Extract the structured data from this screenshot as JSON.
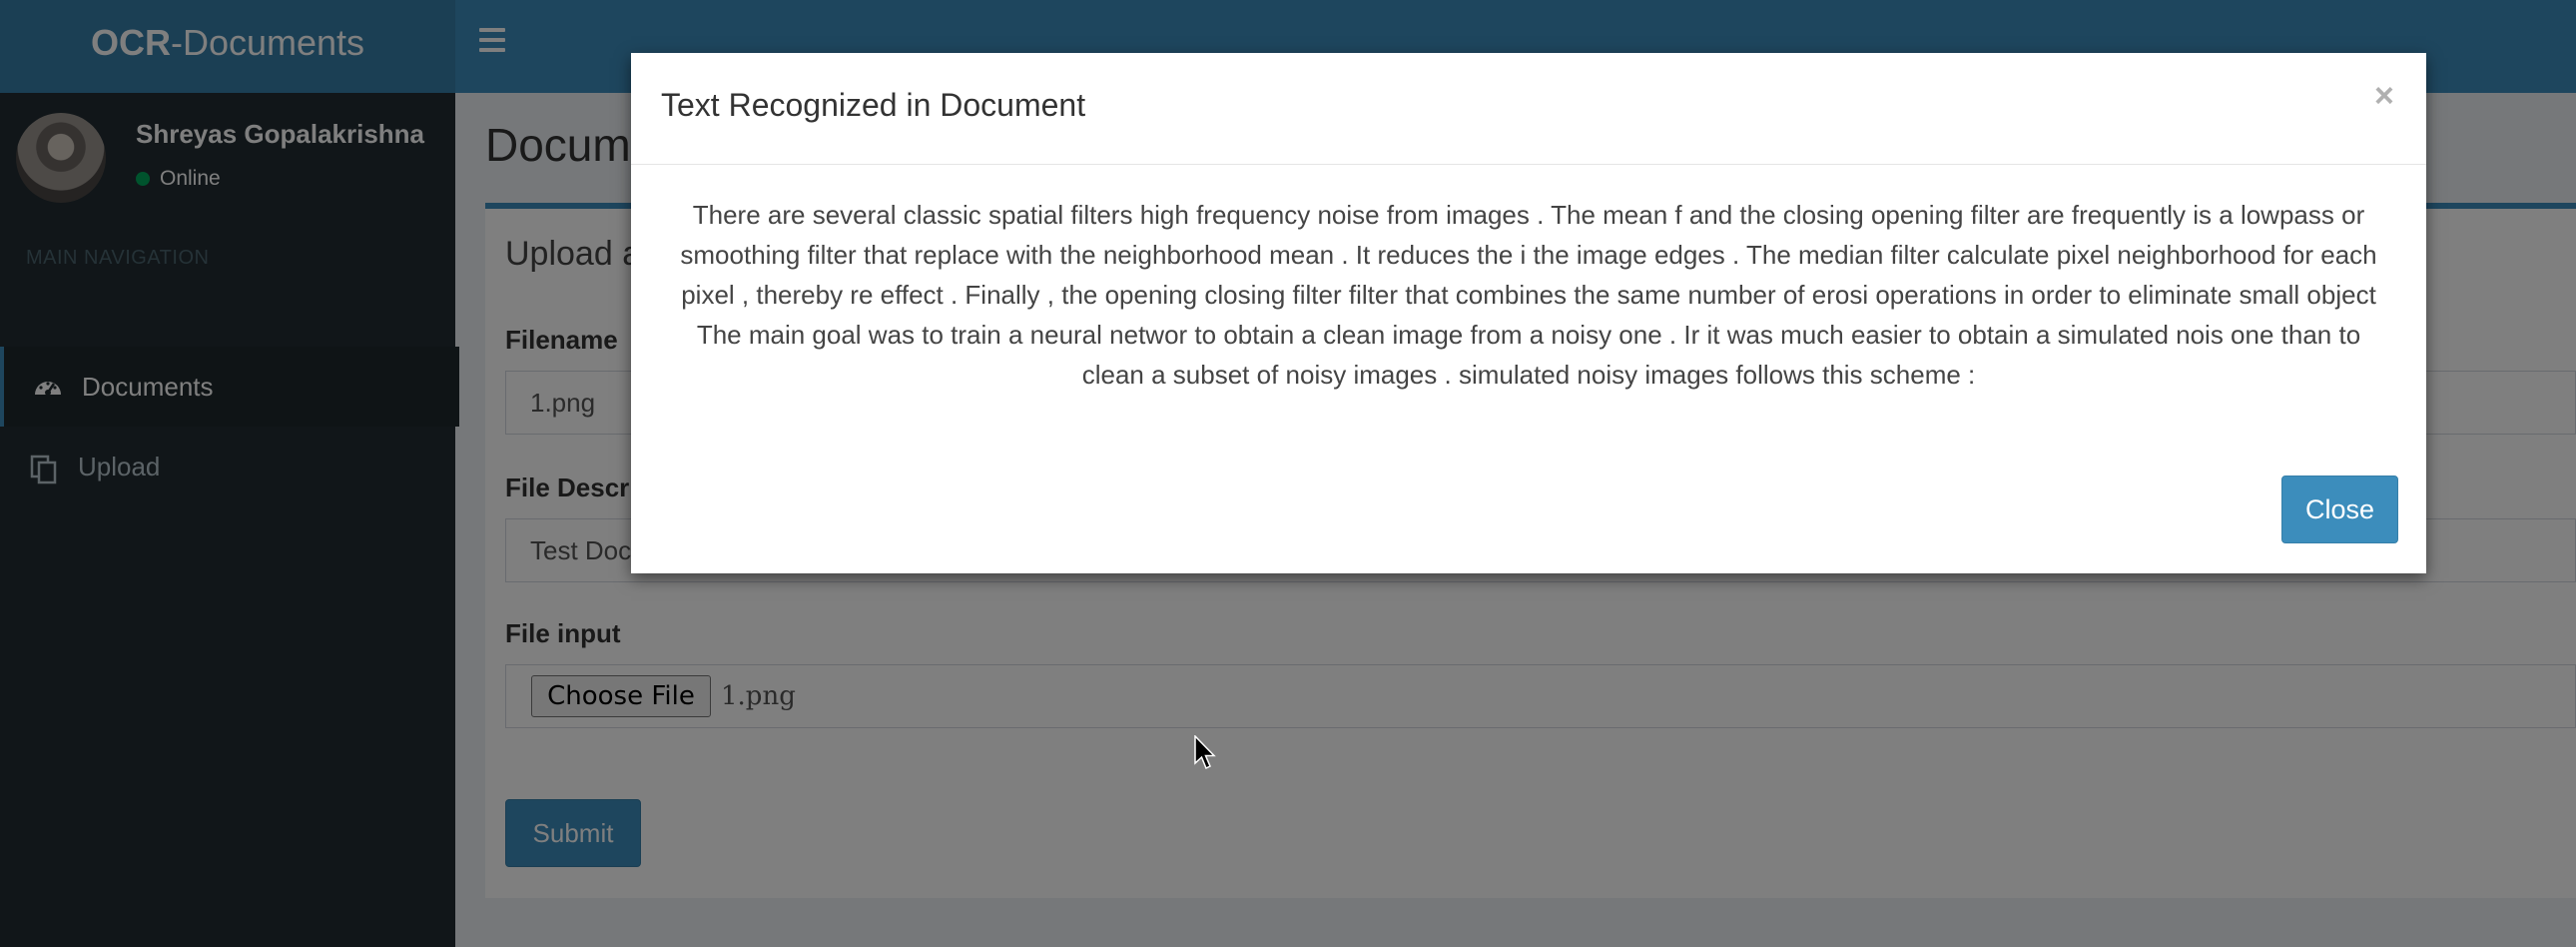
{
  "header": {
    "logo_bold": "OCR",
    "logo_rest": "-Documents",
    "menu_icon": "hamburger-menu-icon"
  },
  "sidebar": {
    "user": {
      "name": "Shreyas Gopalakrishna",
      "status": "Online"
    },
    "nav_header": "MAIN NAVIGATION",
    "items": [
      {
        "label": "Documents",
        "icon": "dashboard-icon",
        "active": true
      },
      {
        "label": "Upload",
        "icon": "copy-icon",
        "active": false
      }
    ]
  },
  "main": {
    "page_title": "Documents",
    "box_title": "Upload a Document",
    "fields": {
      "filename_label": "Filename",
      "filename_value": "1.png",
      "description_label": "File Description",
      "description_value": "Test Document",
      "file_input_label": "File input",
      "choose_file_label": "Choose File",
      "chosen_file": "1.png"
    },
    "submit_label": "Submit"
  },
  "modal": {
    "title": "Text Recognized in Document",
    "close_x": "×",
    "body_lines": [
      "There are several classic spatial filters high frequency noise from images . The mean f and the closing opening filter are frequently is a lowpass or",
      "smoothing filter that replace with the neighborhood mean . It reduces the i the image edges . The median filter calculate pixel neighborhood for each",
      "pixel , thereby re effect . Finally , the opening closing filter filter that combines the same number of erosi operations in order to eliminate small object",
      "The main goal was to train a neural networ to obtain a clean image from a noisy one . Ir it was much easier to obtain a simulated nois one than to",
      "clean a subset of noisy images . simulated noisy images follows this scheme :"
    ],
    "close_button": "Close"
  },
  "colors": {
    "header": "#3c8dbc",
    "logo_bg": "#367fa9",
    "sidebar": "#222d32",
    "accent": "#3c8dbc",
    "online": "#00a65a"
  }
}
